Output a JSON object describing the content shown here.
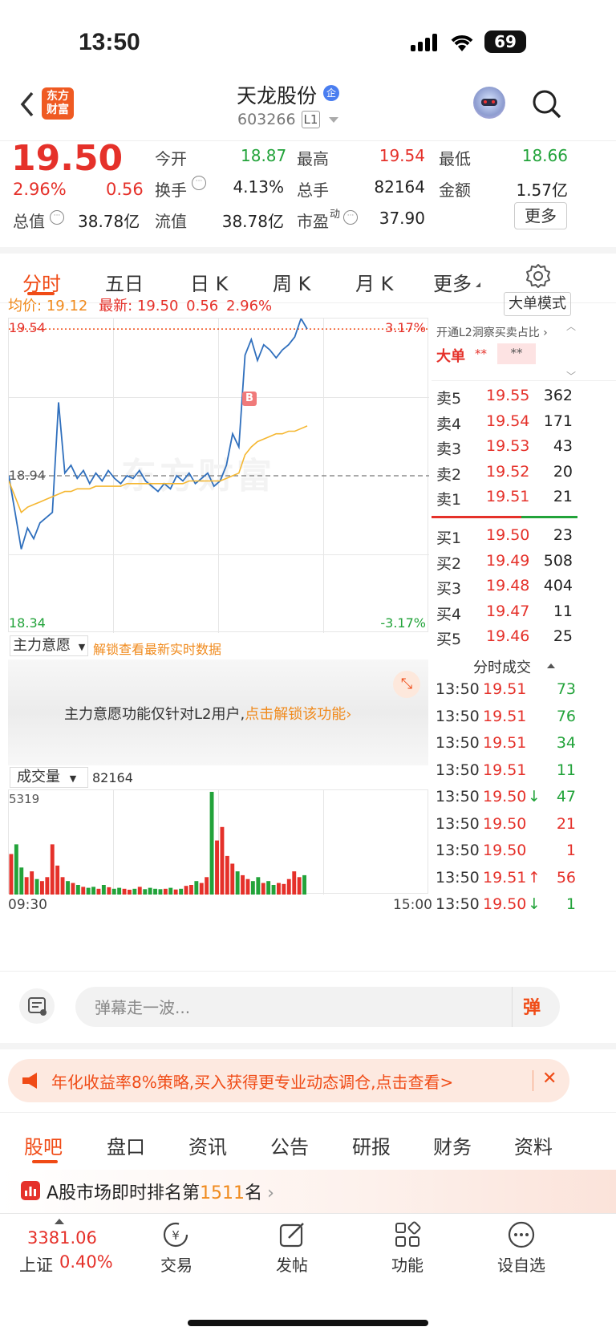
{
  "status_bar": {
    "time": "13:50",
    "battery": "69"
  },
  "header": {
    "back_icon": "chevron-left-icon",
    "logo_line1": "东方",
    "logo_line2": "财富",
    "title": "天龙股份",
    "title_badge": "企",
    "code": "603266",
    "level": "L1",
    "robot_icon": "robot-avatar-icon",
    "search_icon": "search-icon"
  },
  "quote": {
    "price": "19.50",
    "change_pct": "2.96%",
    "change": "0.56",
    "items": [
      {
        "label": "今开",
        "value": "18.87"
      },
      {
        "label": "最高",
        "value": "19.54"
      },
      {
        "label": "最低",
        "value": "18.66"
      },
      {
        "label": "换手",
        "value": "4.13%"
      },
      {
        "label": "总手",
        "value": "82164"
      },
      {
        "label": "金额",
        "value": "1.57亿"
      },
      {
        "label": "总值",
        "value": "38.78亿"
      },
      {
        "label": "流值",
        "value": "38.78亿"
      },
      {
        "label": "市盈",
        "sup": "动",
        "value": "37.90"
      }
    ],
    "more_button": "更多"
  },
  "chart_tabs": [
    "分时",
    "五日",
    "日 K",
    "周 K",
    "月 K",
    "更多"
  ],
  "settings_icon": "gear-icon",
  "intraday": {
    "avg_label": "均价:",
    "avg_value": "19.12",
    "latest_label": "最新:",
    "latest_value": "19.50",
    "latest_change": "0.56",
    "latest_pct": "2.96%",
    "mode_button": "大单模式",
    "y_top": "19.54",
    "y_mid": "18.94",
    "y_bottom": "18.34",
    "pct_top": "3.17%",
    "pct_bottom": "-3.17%",
    "buy_marker": "B",
    "watermark": "东方财富"
  },
  "chart_data": {
    "type": "line",
    "ylim": [
      18.34,
      19.54
    ],
    "x_start": "09:30",
    "x_end": "15:00",
    "series": [
      {
        "name": "",
        "values": [
          18.94,
          18.8,
          18.66,
          18.74,
          18.7,
          18.76,
          18.78,
          18.8,
          19.22,
          18.95,
          18.98,
          18.93,
          18.96,
          18.91,
          18.95,
          18.92,
          18.96,
          18.93,
          18.91,
          18.94,
          18.93,
          18.96,
          18.92,
          18.9,
          18.88,
          18.91,
          18.89,
          18.94,
          18.92,
          18.95,
          18.91,
          18.93,
          18.95,
          18.9,
          18.92,
          18.98,
          19.1,
          19.05,
          19.4,
          19.46,
          19.38,
          19.44,
          19.42,
          19.39,
          19.42,
          19.44,
          19.47,
          19.54,
          19.5
        ]
      },
      {
        "name": "",
        "values": [
          18.92,
          18.86,
          18.8,
          18.82,
          18.83,
          18.84,
          18.85,
          18.86,
          18.87,
          18.88,
          18.88,
          18.89,
          18.89,
          18.89,
          18.9,
          18.9,
          18.9,
          18.9,
          18.9,
          18.91,
          18.91,
          18.91,
          18.91,
          18.91,
          18.91,
          18.91,
          18.91,
          18.91,
          18.91,
          18.92,
          18.92,
          18.92,
          18.92,
          18.92,
          18.92,
          18.93,
          18.94,
          18.95,
          19.02,
          19.05,
          19.07,
          19.08,
          19.09,
          19.1,
          19.1,
          19.11,
          19.11,
          19.12,
          19.13
        ]
      }
    ],
    "volume_label": "成交量",
    "volume_total": "82164",
    "volume_max_label": "5319",
    "volume": [
      2100,
      2600,
      1400,
      900,
      1200,
      800,
      700,
      900,
      2600,
      1500,
      900,
      700,
      600,
      500,
      400,
      350,
      400,
      300,
      500,
      380,
      300,
      350,
      300,
      250,
      300,
      400,
      280,
      350,
      300,
      280,
      300,
      350,
      260,
      300,
      450,
      500,
      700,
      600,
      900,
      5319,
      2800,
      3500,
      2000,
      1600,
      1200,
      1000,
      800,
      700,
      900,
      600,
      700,
      500,
      600,
      550,
      800,
      1200,
      900,
      1000
    ]
  },
  "main_intent": {
    "dropdown": "主力意愿",
    "unlock_link": "解锁查看最新实时数据",
    "notice_text": "主力意愿功能仅针对L2用户,",
    "notice_link": "点击解锁该功能",
    "expand_icon": "expand-icon"
  },
  "l2_panel": {
    "title": "开通L2洞察买卖占比",
    "big_order_label": "大单",
    "stars1": "**",
    "stars2": "**"
  },
  "order_book": {
    "sells": [
      {
        "label": "卖5",
        "price": "19.55",
        "vol": "362"
      },
      {
        "label": "卖4",
        "price": "19.54",
        "vol": "171"
      },
      {
        "label": "卖3",
        "price": "19.53",
        "vol": "43"
      },
      {
        "label": "卖2",
        "price": "19.52",
        "vol": "20"
      },
      {
        "label": "卖1",
        "price": "19.51",
        "vol": "21"
      }
    ],
    "buys": [
      {
        "label": "买1",
        "price": "19.50",
        "vol": "23"
      },
      {
        "label": "买2",
        "price": "19.49",
        "vol": "508"
      },
      {
        "label": "买3",
        "price": "19.48",
        "vol": "404"
      },
      {
        "label": "买4",
        "price": "19.47",
        "vol": "11"
      },
      {
        "label": "买5",
        "price": "19.46",
        "vol": "25"
      }
    ]
  },
  "trades": {
    "title": "分时成交",
    "rows": [
      {
        "time": "13:50",
        "price": "19.51",
        "arrow": "",
        "vol": "73",
        "color": "#22a33a"
      },
      {
        "time": "13:50",
        "price": "19.51",
        "arrow": "",
        "vol": "76",
        "color": "#22a33a"
      },
      {
        "time": "13:50",
        "price": "19.51",
        "arrow": "",
        "vol": "34",
        "color": "#22a33a"
      },
      {
        "time": "13:50",
        "price": "19.51",
        "arrow": "",
        "vol": "11",
        "color": "#22a33a"
      },
      {
        "time": "13:50",
        "price": "19.50",
        "arrow": "↓",
        "vol": "47",
        "color": "#22a33a"
      },
      {
        "time": "13:50",
        "price": "19.50",
        "arrow": "",
        "vol": "21",
        "color": "#e5312a"
      },
      {
        "time": "13:50",
        "price": "19.50",
        "arrow": "",
        "vol": "1",
        "color": "#e5312a"
      },
      {
        "time": "13:50",
        "price": "19.51",
        "arrow": "↑",
        "vol": "56",
        "color": "#e5312a"
      },
      {
        "time": "13:50",
        "price": "19.50",
        "arrow": "↓",
        "vol": "1",
        "color": "#22a33a"
      }
    ]
  },
  "comment_bar": {
    "placeholder": "弹幕走一波...",
    "danmu_button": "弹"
  },
  "banner": {
    "text": "年化收益率8%策略,买入获得更专业动态调仓,点击查看>",
    "close": "✕"
  },
  "bottom_tabs": [
    "股吧",
    "盘口",
    "资讯",
    "公告",
    "研报",
    "财务",
    "资料"
  ],
  "ranking": {
    "prefix": "A股市场即时排名第",
    "rank": "1511",
    "suffix": "名"
  },
  "footer": {
    "index_value": "3381.06",
    "index_name": "上证",
    "index_pct": "0.40%",
    "items": [
      "交易",
      "发帖",
      "功能",
      "设自选"
    ]
  },
  "colors": {
    "up": "#e5312a",
    "down": "#22a33a",
    "accent": "#f04b16",
    "price_line": "#2f6fbd",
    "avg_line": "#f5b731"
  }
}
